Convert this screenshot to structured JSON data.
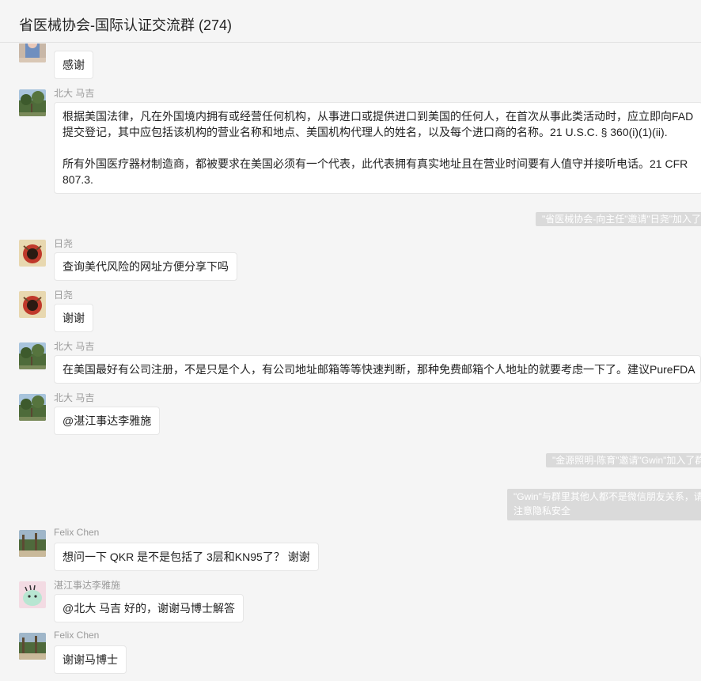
{
  "window": {
    "title": "省医械协会-国际认证交流群 (274)"
  },
  "messages": [
    {
      "sender": "",
      "text": "感谢"
    },
    {
      "sender": "北大 马吉",
      "paragraphs": [
        "根据美国法律，凡在外国境内拥有或经营任何机构，从事进口或提供进口到美国的任何人，在首次从事此类活动时，应立即向FAD提交登记，其中应包括该机构的营业名称和地点、美国机构代理人的姓名，以及每个进口商的名称。21 U.S.C. § 360(i)(1)(ii).",
        "所有外国医疗器材制造商，都被要求在美国必须有一个代表，此代表拥有真实地址且在营业时间要有人值守并接听电话。21 CFR 807.3."
      ]
    },
    {
      "system": "\"省医械协会-向主任\"邀请\"日尧\"加入了群聊"
    },
    {
      "sender": "日尧",
      "text": "查询美代风险的网址方便分享下吗"
    },
    {
      "sender": "日尧",
      "text": "谢谢"
    },
    {
      "sender": "北大 马吉",
      "text": "在美国最好有公司注册，不是只是个人，有公司地址邮箱等等快速判断，那种免费邮箱个人地址的就要考虑一下了。建议PureFDA"
    },
    {
      "sender": "北大 马吉",
      "text": "@湛江事达李雅施"
    },
    {
      "system": "\"金源照明-陈育\"邀请\"Gwin\"加入了群聊"
    },
    {
      "system": "\"Gwin\"与群里其他人都不是微信朋友关系，请注意隐私安全"
    },
    {
      "sender": "Felix Chen",
      "text": "想问一下 QKR 是不是包括了 3层和KN95了？ 谢谢"
    },
    {
      "sender": "湛江事达李雅施",
      "text": "@北大 马吉 好的，谢谢马博士解答"
    },
    {
      "sender": "Felix Chen",
      "text": "谢谢马博士"
    }
  ],
  "colors": {
    "background": "#f5f5f5",
    "bubble": "#ffffff",
    "system_notice": "#dadada",
    "sender_text": "#9a9a9a"
  }
}
